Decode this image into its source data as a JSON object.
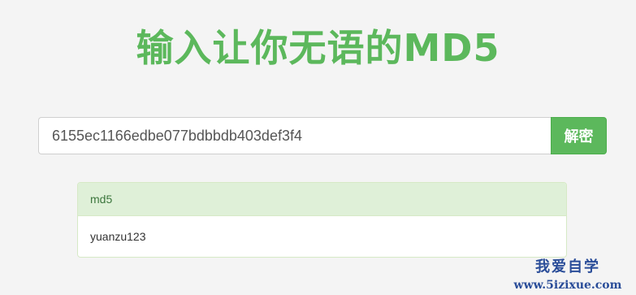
{
  "page": {
    "title": "输入让你无语的MD5"
  },
  "search": {
    "value": "6155ec1166edbe077bdbbdb403def3f4",
    "button_label": "解密"
  },
  "result": {
    "heading": "md5",
    "value": "yuanzu123"
  },
  "watermark": {
    "text": "我爱自学",
    "url": "www.5izixue.com"
  },
  "colors": {
    "brand_green": "#5cb85c",
    "panel_heading_bg": "#dff0d8",
    "watermark": "#2a4d99"
  }
}
